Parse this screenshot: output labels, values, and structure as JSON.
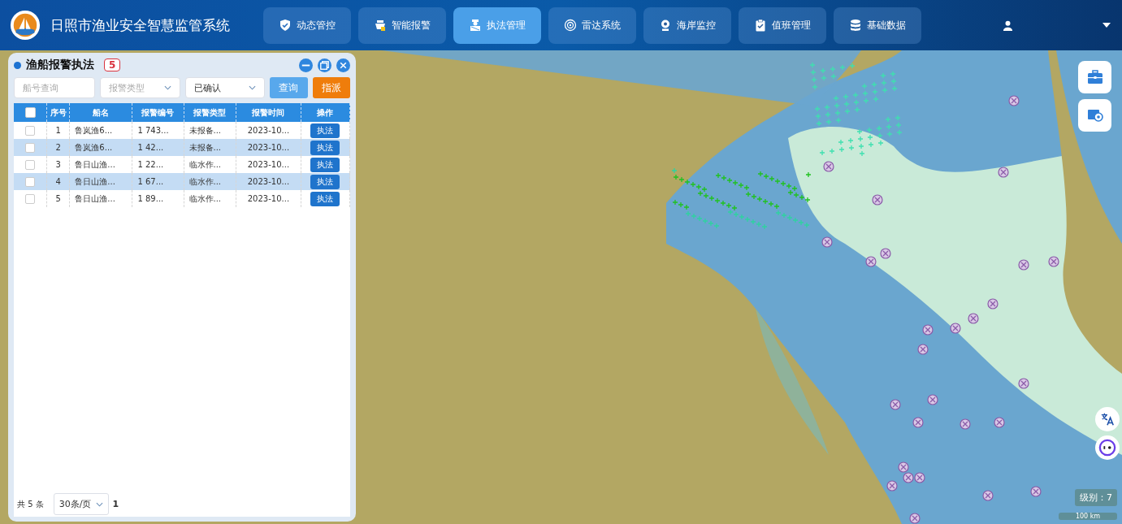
{
  "header": {
    "title": "日照市渔业安全智慧监管系统"
  },
  "nav": [
    {
      "label": "动态管控",
      "kind": "shield",
      "selected": false
    },
    {
      "label": "智能报警",
      "kind": "alarm",
      "selected": false
    },
    {
      "label": "执法管理",
      "kind": "officer",
      "selected": true
    },
    {
      "label": "雷达系统",
      "kind": "radar",
      "selected": false
    },
    {
      "label": "海岸监控",
      "kind": "camera",
      "selected": false
    },
    {
      "label": "值班管理",
      "kind": "clipboard",
      "selected": false
    },
    {
      "label": "基础数据",
      "kind": "database",
      "selected": false
    }
  ],
  "panel": {
    "title": "渔船报警执法",
    "count": "5",
    "filters": {
      "ship_placeholder": "船号查询",
      "type_placeholder": "报警类型",
      "status_value": "已确认"
    },
    "buttons": {
      "query": "查询",
      "assign": "指派"
    },
    "table": {
      "all_checked": false,
      "columns": [
        "序号",
        "船名",
        "报警编号",
        "报警类型",
        "报警时间",
        "操作"
      ],
      "rows": [
        {
          "index": "1",
          "ship": "鲁岚渔6...",
          "alarm_no": "1 743...",
          "type": "未报备...",
          "time": "2023-10...",
          "action": "执法",
          "selected": false,
          "checked": false
        },
        {
          "index": "2",
          "ship": "鲁岚渔6...",
          "alarm_no": "1 42...",
          "type": "未报备...",
          "time": "2023-10...",
          "action": "执法",
          "selected": true,
          "checked": false
        },
        {
          "index": "3",
          "ship": "鲁日山渔...",
          "alarm_no": "1 22...",
          "type": "临水作...",
          "time": "2023-10...",
          "action": "执法",
          "selected": false,
          "checked": false
        },
        {
          "index": "4",
          "ship": "鲁日山渔...",
          "alarm_no": "1 67...",
          "type": "临水作...",
          "time": "2023-10...",
          "action": "执法",
          "selected": true,
          "checked": false
        },
        {
          "index": "5",
          "ship": "鲁日山渔...",
          "alarm_no": "1 89...",
          "type": "临水作...",
          "time": "2023-10...",
          "action": "执法",
          "selected": false,
          "checked": false
        }
      ]
    },
    "pagination": {
      "total": "共 5 条",
      "page_size": "30条/页",
      "page": "1"
    }
  },
  "map": {
    "zoom_level": "级别：7",
    "scale": "100 km"
  }
}
